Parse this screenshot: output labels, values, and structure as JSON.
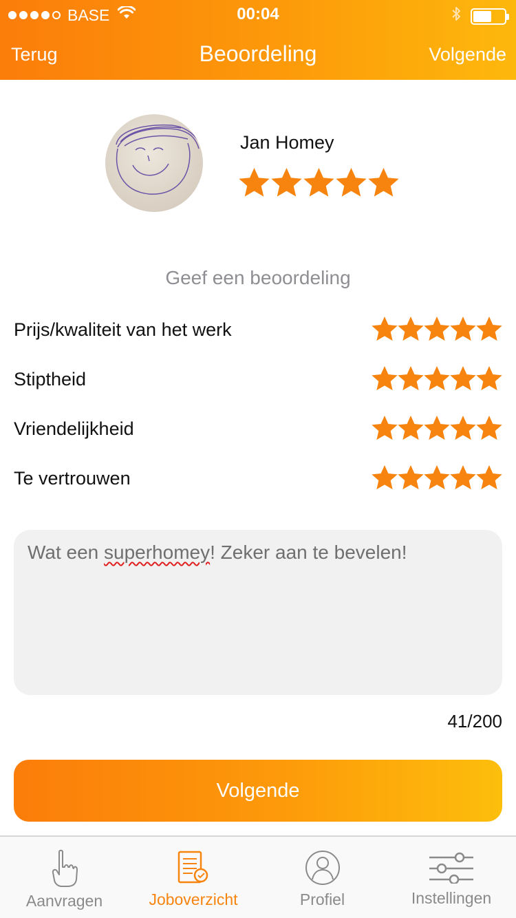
{
  "status_bar": {
    "carrier": "BASE",
    "time": "00:04",
    "signal_bars": 4,
    "battery_level": 0.6
  },
  "nav": {
    "back_label": "Terug",
    "title": "Beoordeling",
    "next_label": "Volgende"
  },
  "profile": {
    "name": "Jan Homey",
    "rating": 5,
    "avatar": "drawn-face-avatar"
  },
  "rating_section": {
    "heading": "Geef een beoordeling",
    "criteria": [
      {
        "label": "Prijs/kwaliteit van het werk",
        "stars": 5
      },
      {
        "label": "Stiptheid",
        "stars": 5
      },
      {
        "label": "Vriendelijkheid",
        "stars": 5
      },
      {
        "label": "Te vertrouwen",
        "stars": 5
      }
    ]
  },
  "comment": {
    "before": "Wat een ",
    "misspelled": "superhomey",
    "after": "! Zeker aan te bevelen!",
    "char_count": "41/200"
  },
  "primary_button": {
    "label": "Volgende"
  },
  "tabbar": {
    "tabs": [
      {
        "label": "Aanvragen",
        "icon": "hand-pointing-icon",
        "active": false
      },
      {
        "label": "Joboverzicht",
        "icon": "document-check-icon",
        "active": true
      },
      {
        "label": "Profiel",
        "icon": "user-icon",
        "active": false
      },
      {
        "label": "Instellingen",
        "icon": "sliders-icon",
        "active": false
      }
    ]
  },
  "colors": {
    "accent": "#f7840e",
    "gradient_start": "#fb7d0a",
    "gradient_end": "#fdb80c",
    "star": "#f7840e"
  }
}
